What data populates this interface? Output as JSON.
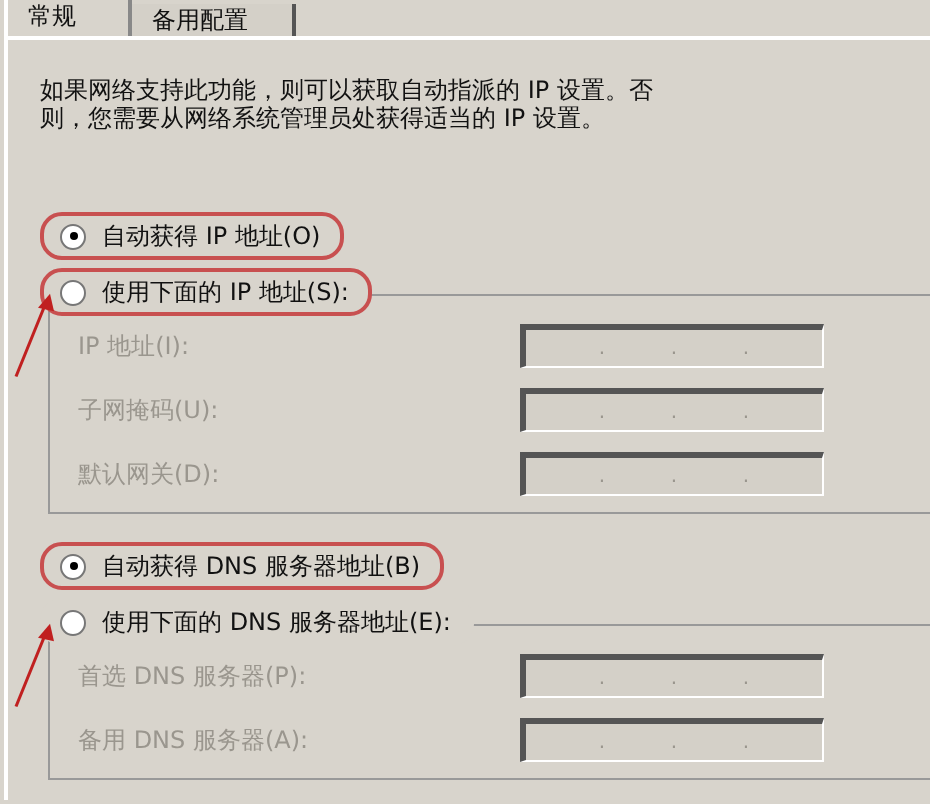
{
  "tabs": [
    {
      "label": "常规",
      "selected": true
    },
    {
      "label": "备用配置",
      "selected": false
    }
  ],
  "description": "如果网络支持此功能，则可以获取自动指派的 IP 设置。否则，您需要从网络系统管理员处获得适当的 IP 设置。",
  "sections": [
    {
      "auto": {
        "label": "自动获得 IP 地址(O)",
        "selected": true,
        "highlighted": true,
        "arrowed": false
      },
      "manual": {
        "label": "使用下面的 IP 地址(S):",
        "selected": false,
        "highlighted": true,
        "arrowed": true
      },
      "fields": [
        {
          "label": "IP 地址(I):",
          "disabled": true,
          "separators": [
            ".",
            ".",
            "."
          ]
        },
        {
          "label": "子网掩码(U):",
          "disabled": true,
          "separators": [
            ".",
            ".",
            "."
          ]
        },
        {
          "label": "默认网关(D):",
          "disabled": true,
          "separators": [
            ".",
            ".",
            "."
          ]
        }
      ]
    },
    {
      "auto": {
        "label": "自动获得 DNS 服务器地址(B)",
        "selected": true,
        "highlighted": true,
        "arrowed": false
      },
      "manual": {
        "label": "使用下面的 DNS 服务器地址(E):",
        "selected": false,
        "highlighted": false,
        "arrowed": true
      },
      "fields": [
        {
          "label": "首选 DNS 服务器(P):",
          "disabled": true,
          "separators": [
            ".",
            ".",
            "."
          ]
        },
        {
          "label": "备用 DNS 服务器(A):",
          "disabled": true,
          "separators": [
            ".",
            ".",
            "."
          ]
        }
      ]
    }
  ]
}
